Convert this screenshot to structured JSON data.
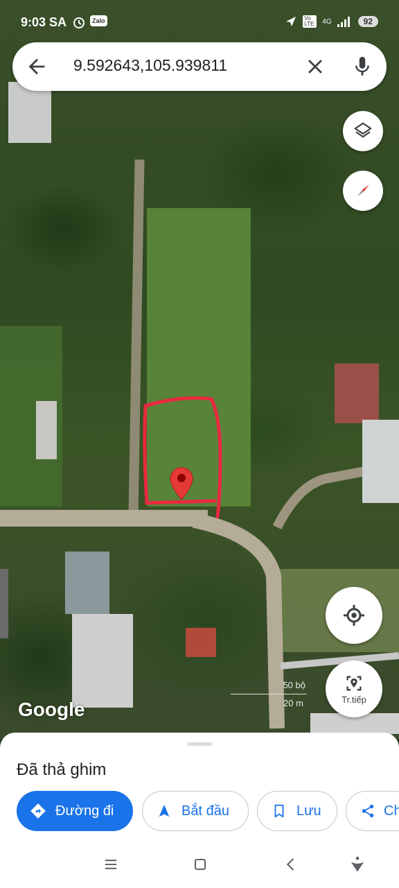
{
  "status_bar": {
    "time": "9:03 SA",
    "alarm_icon": "alarm-icon",
    "zalo_badge": "Zalo",
    "network": "4G",
    "volte": "Vo LTE",
    "battery": "92"
  },
  "search": {
    "query": "9.592643,105.939811",
    "back_icon": "arrow-back-icon",
    "clear_icon": "close-icon",
    "mic_icon": "microphone-icon"
  },
  "map": {
    "attribution": "Google",
    "scale_ft": "50 bộ",
    "scale_m": "20 m",
    "pin_color": "#e53935",
    "outline_color": "#e8293f"
  },
  "fabs": {
    "layers_icon": "layers-icon",
    "compass_icon": "compass-icon",
    "my_location_icon": "my-location-icon",
    "live_view_label": "Tr.tiếp"
  },
  "sheet": {
    "title": "Đã thả ghim",
    "chips": [
      {
        "label": "Đường đi",
        "icon": "directions-icon"
      },
      {
        "label": "Bắt đầu",
        "icon": "navigation-arrow-icon"
      },
      {
        "label": "Lưu",
        "icon": "bookmark-icon"
      },
      {
        "label": "Ch",
        "icon": "share-icon"
      }
    ],
    "accent": "#1a73e8"
  },
  "navbar": {
    "menu_icon": "menu-icon",
    "home_icon": "home-square-icon",
    "back_icon": "back-chevron-icon",
    "assistant_icon": "assistant-icon"
  }
}
